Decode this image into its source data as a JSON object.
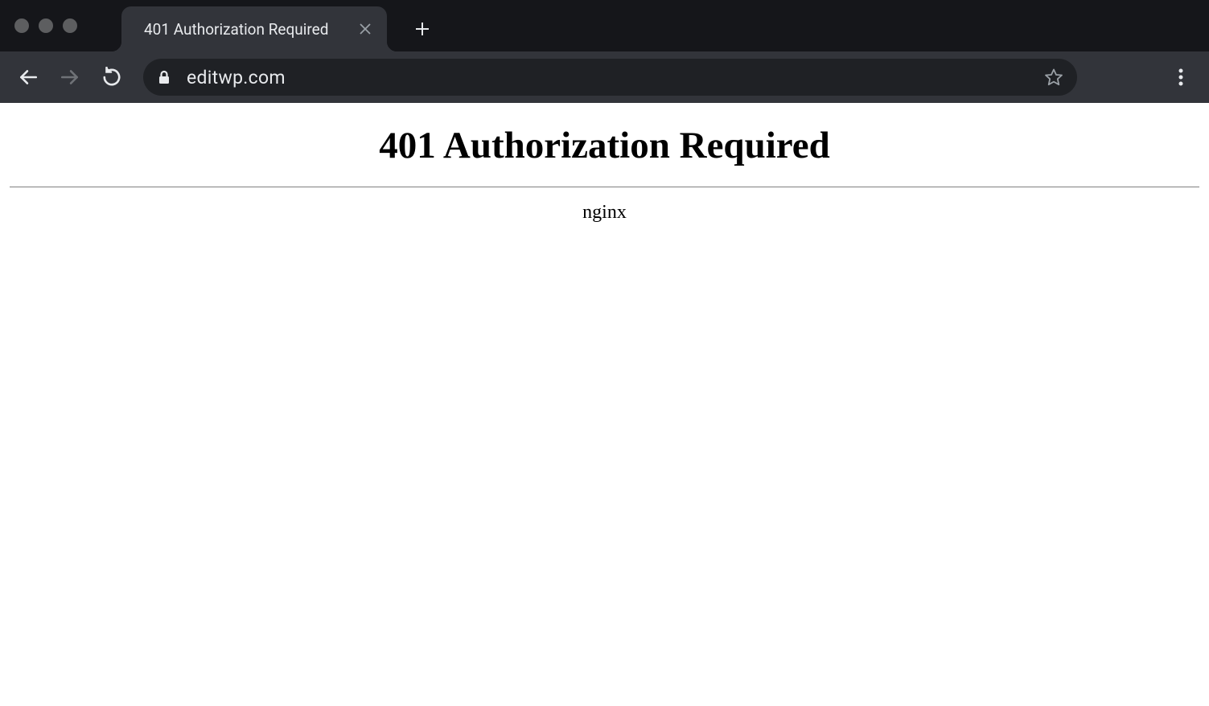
{
  "browser": {
    "tab": {
      "title": "401 Authorization Required"
    },
    "address": {
      "url": "editwp.com"
    }
  },
  "page": {
    "heading": "401 Authorization Required",
    "server": "nginx"
  }
}
